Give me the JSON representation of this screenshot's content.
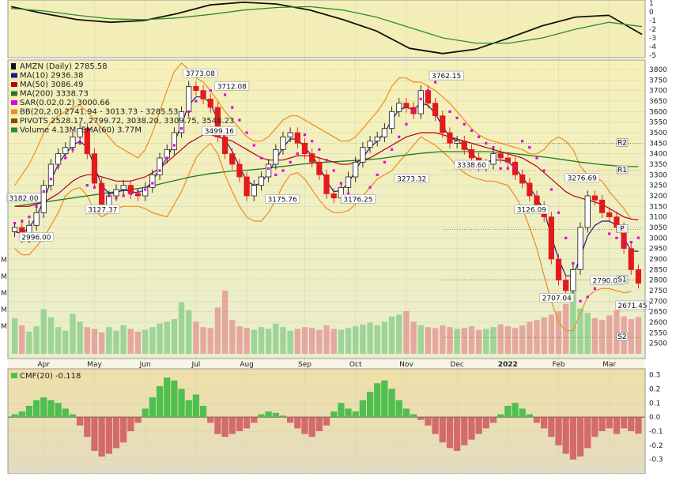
{
  "chart_data": [
    {
      "panel": "indicator-top",
      "type": "line",
      "ytick_labels": [
        "1",
        "0",
        "-1",
        "-2",
        "-3",
        "-4",
        "-5"
      ],
      "ylim": [
        -5,
        1
      ],
      "series": [
        {
          "color": "#111111",
          "values": [
            0.6,
            -0.2,
            -0.9,
            -1.2,
            -1.0,
            -0.2,
            0.8,
            1.1,
            0.9,
            0.2,
            -0.9,
            -2.2,
            -4.2,
            -4.8,
            -4.3,
            -3.0,
            -1.6,
            -0.6,
            -0.4,
            -2.6
          ]
        },
        {
          "color": "#2e8b2e",
          "values": [
            0.4,
            0.1,
            -0.4,
            -0.8,
            -0.9,
            -0.7,
            -0.3,
            0.2,
            0.5,
            0.6,
            0.2,
            -0.6,
            -1.8,
            -3.0,
            -3.6,
            -3.6,
            -3.0,
            -2.0,
            -1.2,
            -1.7
          ]
        }
      ]
    },
    {
      "panel": "price",
      "type": "candlestick",
      "legend": [
        {
          "label": "AMZN (Daily) 2785.58",
          "color": "#111111"
        },
        {
          "label": "MA(10) 2936.38",
          "color": "#1a1a8c"
        },
        {
          "label": "MA(50) 3086.49",
          "color": "#b3001b"
        },
        {
          "label": "MA(200) 3338.73",
          "color": "#1f7a1f"
        },
        {
          "label": "SAR(0.02,0.2) 3000.66",
          "color": "#e000e0"
        },
        {
          "label": "BB(20,2.0) 2741.94 - 3013.73 - 3285.53",
          "color": "#f08c1a"
        },
        {
          "label": "PIVOTS 2528.17, 2799.72, 3038.20, 3309.75, 3548.23",
          "color": "#8b4513"
        },
        {
          "label": "Volume 4.13M, EMA(60) 3.77M",
          "color": "#2e8b2e"
        }
      ],
      "ylim": [
        2450,
        3830
      ],
      "yticks": [
        2500,
        2550,
        2600,
        2650,
        2700,
        2750,
        2800,
        2850,
        2900,
        2950,
        3000,
        3050,
        3100,
        3150,
        3200,
        3250,
        3300,
        3350,
        3400,
        3450,
        3500,
        3550,
        3600,
        3650,
        3700,
        3750,
        3800
      ],
      "x_labels": [
        "Apr",
        "May",
        "Jun",
        "Jul",
        "Aug",
        "Sep",
        "Oct",
        "Nov",
        "Dec",
        "2022",
        "Feb",
        "Mar"
      ],
      "closes": [
        3050,
        3000,
        3060,
        3120,
        3250,
        3350,
        3400,
        3430,
        3480,
        3520,
        3400,
        3260,
        3150,
        3200,
        3230,
        3250,
        3210,
        3200,
        3240,
        3300,
        3380,
        3420,
        3500,
        3600,
        3720,
        3700,
        3660,
        3620,
        3480,
        3400,
        3350,
        3290,
        3200,
        3250,
        3290,
        3350,
        3420,
        3480,
        3500,
        3450,
        3400,
        3360,
        3300,
        3210,
        3190,
        3240,
        3290,
        3360,
        3430,
        3460,
        3480,
        3520,
        3600,
        3640,
        3620,
        3590,
        3700,
        3640,
        3580,
        3500,
        3450,
        3460,
        3420,
        3380,
        3340,
        3350,
        3400,
        3380,
        3360,
        3300,
        3260,
        3200,
        3150,
        3100,
        2900,
        2800,
        2750,
        2850,
        3050,
        3200,
        3180,
        3120,
        3100,
        3050,
        2950,
        2850,
        2785
      ],
      "candle_colors": {
        "up": "#1a1a1a",
        "down": "#e41a1a"
      },
      "ma10": [
        3030,
        3020,
        3050,
        3100,
        3180,
        3270,
        3350,
        3400,
        3440,
        3460,
        3430,
        3340,
        3250,
        3210,
        3215,
        3230,
        3220,
        3215,
        3230,
        3270,
        3330,
        3380,
        3450,
        3540,
        3630,
        3670,
        3670,
        3640,
        3560,
        3470,
        3410,
        3340,
        3270,
        3250,
        3260,
        3310,
        3370,
        3430,
        3470,
        3470,
        3430,
        3390,
        3340,
        3270,
        3220,
        3225,
        3260,
        3320,
        3380,
        3430,
        3460,
        3500,
        3560,
        3610,
        3620,
        3610,
        3640,
        3630,
        3590,
        3530,
        3480,
        3460,
        3440,
        3400,
        3370,
        3360,
        3370,
        3370,
        3365,
        3330,
        3290,
        3240,
        3190,
        3130,
        3010,
        2900,
        2820,
        2820,
        2910,
        3010,
        3060,
        3080,
        3080,
        3060,
        3000,
        2940,
        2936
      ],
      "ma50": [
        3150,
        3150,
        3150,
        3160,
        3170,
        3190,
        3210,
        3240,
        3270,
        3290,
        3300,
        3300,
        3290,
        3280,
        3270,
        3270,
        3270,
        3280,
        3290,
        3310,
        3330,
        3360,
        3390,
        3420,
        3450,
        3470,
        3490,
        3490,
        3480,
        3470,
        3460,
        3440,
        3420,
        3400,
        3380,
        3370,
        3370,
        3370,
        3380,
        3390,
        3390,
        3390,
        3380,
        3370,
        3360,
        3350,
        3350,
        3360,
        3370,
        3380,
        3400,
        3420,
        3440,
        3460,
        3480,
        3490,
        3500,
        3500,
        3500,
        3490,
        3480,
        3470,
        3460,
        3450,
        3440,
        3430,
        3420,
        3410,
        3400,
        3390,
        3380,
        3360,
        3340,
        3310,
        3280,
        3250,
        3220,
        3200,
        3190,
        3180,
        3170,
        3160,
        3140,
        3120,
        3100,
        3090,
        3086
      ],
      "ma200": [
        3150,
        3155,
        3160,
        3165,
        3170,
        3175,
        3180,
        3185,
        3190,
        3195,
        3200,
        3205,
        3210,
        3215,
        3220,
        3225,
        3230,
        3235,
        3240,
        3248,
        3256,
        3264,
        3272,
        3280,
        3288,
        3294,
        3300,
        3306,
        3310,
        3314,
        3318,
        3320,
        3322,
        3325,
        3328,
        3332,
        3336,
        3340,
        3344,
        3348,
        3352,
        3355,
        3358,
        3360,
        3362,
        3364,
        3366,
        3368,
        3370,
        3373,
        3376,
        3380,
        3385,
        3390,
        3394,
        3398,
        3402,
        3405,
        3408,
        3410,
        3410,
        3410,
        3410,
        3410,
        3410,
        3410,
        3408,
        3406,
        3404,
        3400,
        3396,
        3392,
        3388,
        3384,
        3380,
        3375,
        3370,
        3365,
        3360,
        3356,
        3352,
        3348,
        3345,
        3342,
        3340,
        3339,
        3338.73
      ],
      "bb_upper": [
        3250,
        3300,
        3350,
        3420,
        3500,
        3550,
        3580,
        3600,
        3620,
        3630,
        3600,
        3560,
        3520,
        3480,
        3440,
        3420,
        3400,
        3380,
        3420,
        3500,
        3600,
        3700,
        3790,
        3830,
        3800,
        3760,
        3740,
        3700,
        3650,
        3600,
        3560,
        3520,
        3480,
        3460,
        3460,
        3480,
        3520,
        3560,
        3580,
        3580,
        3560,
        3540,
        3520,
        3500,
        3480,
        3460,
        3460,
        3480,
        3520,
        3560,
        3600,
        3650,
        3720,
        3760,
        3760,
        3740,
        3740,
        3720,
        3700,
        3670,
        3640,
        3600,
        3560,
        3520,
        3490,
        3470,
        3460,
        3450,
        3440,
        3430,
        3420,
        3400,
        3400,
        3420,
        3460,
        3480,
        3460,
        3420,
        3340,
        3300,
        3290,
        3270,
        3220,
        3180,
        3140,
        3090,
        3285.53
      ],
      "bb_lower": [
        2950,
        2920,
        2920,
        2960,
        3000,
        3060,
        3120,
        3200,
        3230,
        3240,
        3200,
        3130,
        3100,
        3120,
        3140,
        3150,
        3150,
        3150,
        3140,
        3120,
        3110,
        3100,
        3160,
        3220,
        3300,
        3380,
        3420,
        3450,
        3400,
        3300,
        3220,
        3150,
        3100,
        3080,
        3080,
        3120,
        3180,
        3250,
        3300,
        3310,
        3280,
        3230,
        3180,
        3140,
        3120,
        3120,
        3130,
        3160,
        3200,
        3240,
        3280,
        3300,
        3320,
        3360,
        3400,
        3440,
        3480,
        3460,
        3440,
        3410,
        3380,
        3340,
        3310,
        3290,
        3280,
        3270,
        3270,
        3260,
        3250,
        3200,
        3140,
        3050,
        2950,
        2820,
        2700,
        2600,
        2560,
        2560,
        2640,
        2720,
        2750,
        2760,
        2760,
        2750,
        2740,
        2745,
        2741.94
      ],
      "sar_points": [
        3070,
        3080,
        3100,
        3150,
        3220,
        3280,
        3340,
        3380,
        3420,
        3450,
        3250,
        3240,
        3220,
        3200,
        3190,
        3200,
        3210,
        3220,
        3230,
        3260,
        3320,
        3380,
        3440,
        3520,
        3600,
        3650,
        3690,
        3700,
        3710,
        3680,
        3620,
        3560,
        3500,
        3440,
        3380,
        3330,
        3300,
        3320,
        3360,
        3400,
        3490,
        3460,
        3420,
        3370,
        3320,
        3260,
        3210,
        3190,
        3200,
        3240,
        3300,
        3360,
        3420,
        3480,
        3540,
        3600,
        3660,
        3700,
        3740,
        3760,
        3600,
        3570,
        3540,
        3510,
        3480,
        3450,
        3430,
        3330,
        3330,
        3340,
        3460,
        3430,
        3380,
        3320,
        3230,
        3120,
        3000,
        2880,
        2700,
        2720,
        2760,
        2800,
        3020,
        3000,
        2990,
        2980,
        3000.66
      ],
      "callouts": [
        "3182.00",
        "2996.00",
        "3127.37",
        "3773.08",
        "3712.08",
        "3499.16",
        "3175.76",
        "3176.25",
        "3273.32",
        "3762.15",
        "3338.60",
        "3126.09",
        "3276.69",
        "2707.04",
        "2790.00",
        "2671.45"
      ],
      "pivot_labels": [
        "R2",
        "R1",
        "P",
        "S1",
        "S2"
      ],
      "volume_legend_marks": [
        "M",
        "M",
        "M",
        "M",
        "M"
      ],
      "volume": [
        4.0,
        3.2,
        2.5,
        3.1,
        5.0,
        4.1,
        3.0,
        2.6,
        4.5,
        3.6,
        3.0,
        2.8,
        2.4,
        3.0,
        2.6,
        3.2,
        2.8,
        2.5,
        2.7,
        3.0,
        3.4,
        3.6,
        3.9,
        5.8,
        4.9,
        3.6,
        3.0,
        2.9,
        5.2,
        7.1,
        3.8,
        3.1,
        2.9,
        2.7,
        3.0,
        2.8,
        3.4,
        3.0,
        2.6,
        2.8,
        3.0,
        2.9,
        2.7,
        3.2,
        2.8,
        2.7,
        2.9,
        3.1,
        3.3,
        3.5,
        3.2,
        3.6,
        4.2,
        4.4,
        4.8,
        3.6,
        3.2,
        3.0,
        2.9,
        3.2,
        3.0,
        2.8,
        2.9,
        3.1,
        2.7,
        2.8,
        3.0,
        3.3,
        3.1,
        2.9,
        3.2,
        3.6,
        3.8,
        4.1,
        4.4,
        4.8,
        5.6,
        7.0,
        5.1,
        4.6,
        4.0,
        3.8,
        4.3,
        4.9,
        4.2,
        3.9,
        4.13
      ]
    },
    {
      "panel": "cmf",
      "type": "bar",
      "legend_label": "CMF(20) -0.118",
      "ylim": [
        -0.38,
        0.32
      ],
      "ytick_labels": [
        "0.3",
        "0.2",
        "0.1",
        "0.0",
        "-0.1",
        "-0.2",
        "-0.3"
      ],
      "colors": {
        "positive": "#4fbf4f",
        "negative": "#d46a6a"
      },
      "values": [
        0.02,
        0.04,
        0.08,
        0.12,
        0.14,
        0.12,
        0.1,
        0.06,
        0.02,
        -0.06,
        -0.14,
        -0.24,
        -0.28,
        -0.26,
        -0.22,
        -0.18,
        -0.1,
        -0.04,
        0.06,
        0.14,
        0.22,
        0.28,
        0.26,
        0.2,
        0.12,
        0.16,
        0.08,
        -0.04,
        -0.12,
        -0.14,
        -0.12,
        -0.1,
        -0.08,
        -0.04,
        0.02,
        0.04,
        0.03,
        0.01,
        -0.04,
        -0.08,
        -0.12,
        -0.14,
        -0.1,
        -0.06,
        0.04,
        0.1,
        0.06,
        0.04,
        0.12,
        0.18,
        0.24,
        0.26,
        0.2,
        0.12,
        0.06,
        0.02,
        -0.02,
        -0.06,
        -0.12,
        -0.18,
        -0.22,
        -0.24,
        -0.2,
        -0.16,
        -0.12,
        -0.08,
        -0.04,
        0.02,
        0.08,
        0.1,
        0.06,
        0.02,
        -0.04,
        -0.08,
        -0.14,
        -0.2,
        -0.26,
        -0.3,
        -0.28,
        -0.22,
        -0.14,
        -0.1,
        -0.08,
        -0.12,
        -0.08,
        -0.1,
        -0.118
      ]
    }
  ]
}
